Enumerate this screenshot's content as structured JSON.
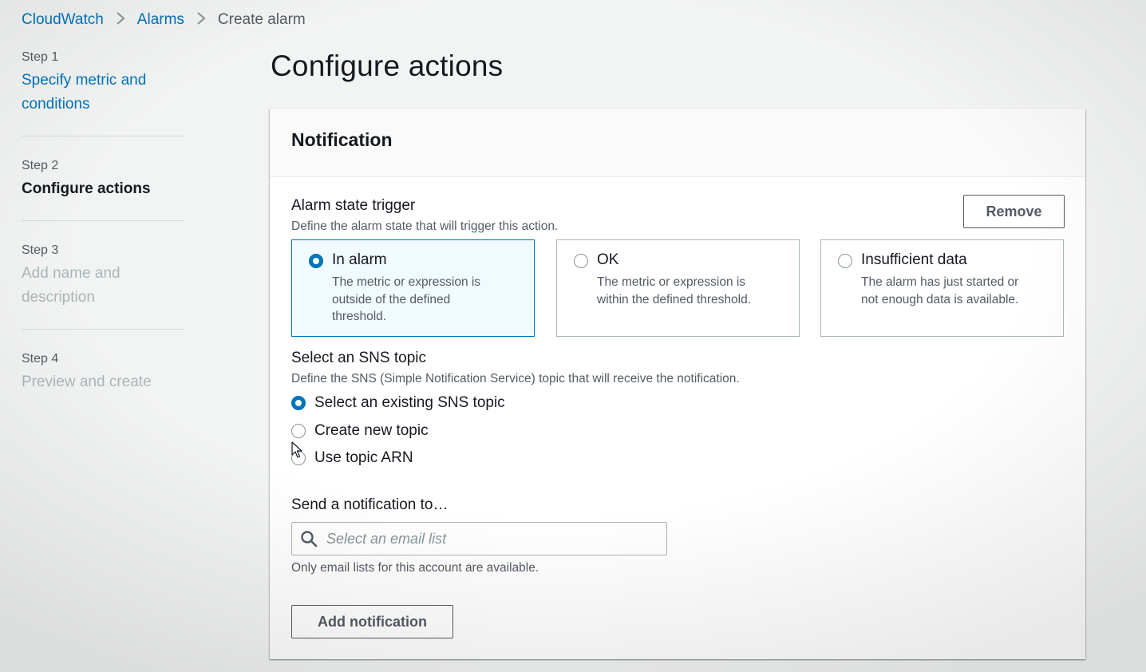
{
  "breadcrumb": {
    "items": [
      "CloudWatch",
      "Alarms"
    ],
    "current": "Create alarm"
  },
  "steps": [
    {
      "num": "Step 1",
      "label_line1": "Specify metric and",
      "label_line2": "conditions",
      "state": "link"
    },
    {
      "num": "Step 2",
      "label_line1": "Configure actions",
      "label_line2": "",
      "state": "active"
    },
    {
      "num": "Step 3",
      "label_line1": "Add name and",
      "label_line2": "description",
      "state": "disabled"
    },
    {
      "num": "Step 4",
      "label_line1": "Preview and create",
      "label_line2": "",
      "state": "disabled"
    }
  ],
  "page": {
    "title": "Configure actions"
  },
  "notification": {
    "title": "Notification",
    "remove_label": "Remove",
    "trigger": {
      "label": "Alarm state trigger",
      "description": "Define the alarm state that will trigger this action.",
      "options": [
        {
          "title": "In alarm",
          "desc_line1": "The metric or expression is",
          "desc_line2": "outside of the defined",
          "desc_line3": "threshold.",
          "selected": true
        },
        {
          "title": "OK",
          "desc_line1": "The metric or expression is",
          "desc_line2": "within the defined threshold.",
          "desc_line3": "",
          "selected": false
        },
        {
          "title": "Insufficient data",
          "desc_line1": "The alarm has just started or",
          "desc_line2": "not enough data is available.",
          "desc_line3": "",
          "selected": false
        }
      ]
    },
    "sns": {
      "label": "Select an SNS topic",
      "description": "Define the SNS (Simple Notification Service) topic that will receive the notification.",
      "options": [
        {
          "label": "Select an existing SNS topic",
          "selected": true
        },
        {
          "label": "Create new topic",
          "selected": false
        },
        {
          "label": "Use topic ARN",
          "selected": false
        }
      ]
    },
    "send_to": {
      "label": "Send a notification to…",
      "placeholder": "Select an email list",
      "value": "",
      "hint": "Only email lists for this account are available."
    },
    "add_label": "Add notification"
  },
  "colors": {
    "link": "#0073bb",
    "selected_border": "#0073bb",
    "selected_bg": "#f1faff",
    "text_secondary": "#545b64",
    "disabled": "#aab7b8"
  }
}
